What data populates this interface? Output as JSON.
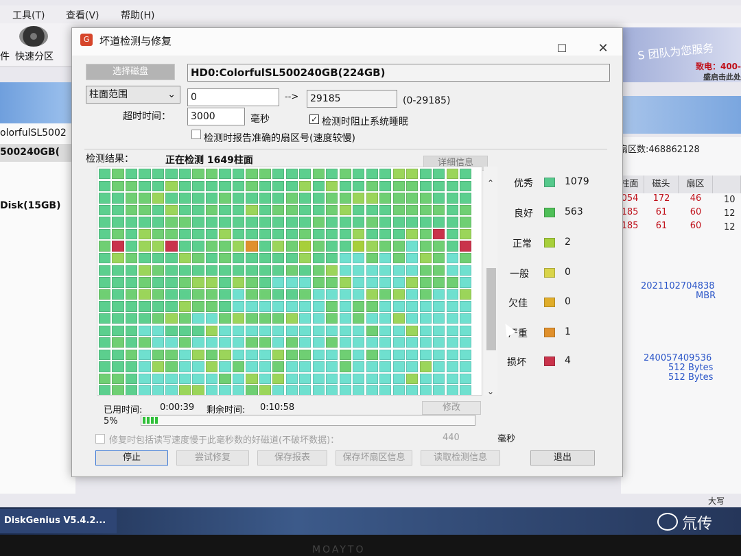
{
  "background": {
    "menus": [
      "工具(T)",
      "查看(V)",
      "帮助(H)"
    ],
    "toolbar": {
      "item_left": "件",
      "quick_partition": "快速分区"
    },
    "banner": {
      "text": "S 团队为您服务",
      "hotline": "致电：400-",
      "hotline2": "盛启击此处"
    },
    "left_panel": {
      "disk_name": "olorfulSL5002",
      "selected": "500240GB(",
      "partition": "Disk(15GB)"
    },
    "right_panel": {
      "sectors": "扇区数:468862128",
      "headers": [
        "柱面",
        "磁头",
        "扇区"
      ],
      "rows": [
        [
          "054",
          "172",
          "46",
          "10"
        ],
        [
          "185",
          "61",
          "60",
          "12"
        ],
        [
          "185",
          "61",
          "60",
          "12"
        ]
      ],
      "serial": "2021102704838",
      "partition_style": "MBR",
      "capacity": "240057409536",
      "sector_size_1": "512 Bytes",
      "sector_size_2": "512 Bytes"
    },
    "caps": "大写",
    "taskbar_app": "DiskGenius V5.4.2...",
    "watermark": "氘传",
    "monitor_brand": "MOAYTO"
  },
  "dialog": {
    "title": "坏道检测与修复",
    "select_disk": "选择磁盘",
    "disk_label": "HD0:ColorfulSL500240GB(224GB)",
    "range_mode": "柱面范围",
    "range_start": "0",
    "arrow": "-->",
    "range_end": "29185",
    "range_hint": "(0-29185)",
    "timeout_label": "超时时间：",
    "timeout_value": "3000",
    "timeout_unit": "毫秒",
    "prevent_sleep": "检测时阻止系统睡眠",
    "report_sector": "检测时报告准确的扇区号(速度较慢)",
    "result_label": "检测结果：",
    "status": "正在检测 1649柱面",
    "detail_button": "详细信息",
    "elapsed_label": "已用时间:",
    "elapsed": "0:00:39",
    "remaining_label": "剩余时间:",
    "remaining": "0:10:58",
    "repair_button": "修改",
    "progress_text": "5%",
    "progress": 0.05,
    "slow_option": "修复时包括读写速度慢于此毫秒数的好磁道(不破坏数据)：",
    "slow_value": "440",
    "slow_unit": "毫秒",
    "buttons": {
      "stop": "停止",
      "try_repair": "尝试修复",
      "save_report": "保存报表",
      "save_sectors": "保存坏扇区信息",
      "read_sectors": "读取检测信息",
      "exit": "退出"
    }
  },
  "legend": [
    {
      "name": "优秀",
      "color": "#56c98c",
      "count": "1079"
    },
    {
      "name": "良好",
      "color": "#4fbf58",
      "count": "563"
    },
    {
      "name": "正常",
      "color": "#a7cf3b",
      "count": "2"
    },
    {
      "name": "一般",
      "color": "#d9d44a",
      "count": "0"
    },
    {
      "name": "欠佳",
      "color": "#e0ad2a",
      "count": "0"
    },
    {
      "name": "严重",
      "color": "#e0902c",
      "count": "1"
    },
    {
      "name": "损坏",
      "color": "#c9334b",
      "count": "4"
    }
  ],
  "grid": {
    "rows": 19,
    "cols": 28,
    "base_colors": [
      "#5ccf8e",
      "#6fcf73",
      "#9bd55a",
      "#6fe0cf"
    ],
    "special_cells": [
      {
        "row": 5,
        "col": 25,
        "color": "#c9334b"
      },
      {
        "row": 6,
        "col": 1,
        "color": "#c9334b"
      },
      {
        "row": 6,
        "col": 5,
        "color": "#c9334b"
      },
      {
        "row": 6,
        "col": 27,
        "color": "#c9334b"
      },
      {
        "row": 6,
        "col": 11,
        "color": "#e0902c"
      },
      {
        "row": 6,
        "col": 15,
        "color": "#a7cf3b"
      },
      {
        "row": 6,
        "col": 19,
        "color": "#a7cf3b"
      }
    ]
  }
}
